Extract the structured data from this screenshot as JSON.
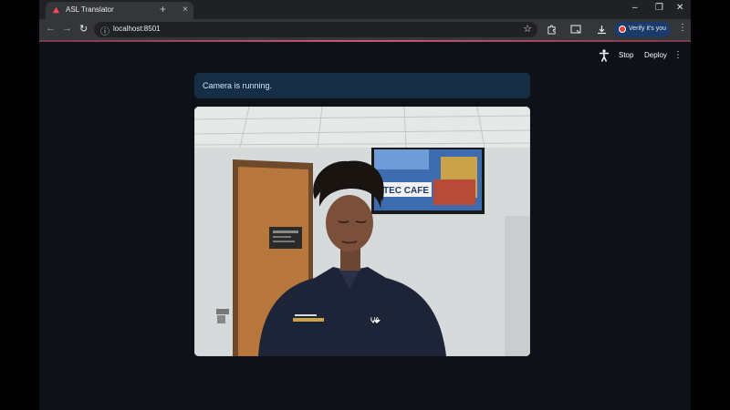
{
  "browser": {
    "tab_title": "ASL Translator",
    "tab_close": "×",
    "new_tab": "+",
    "url": "localhost:8501",
    "verify_label": "Verify it's you",
    "window_controls": [
      "–",
      "❐",
      "✕"
    ],
    "icons": [
      "back-icon",
      "forward-icon",
      "reload-icon",
      "info-icon",
      "star-icon",
      "extensions-icon",
      "cast-icon",
      "download-icon",
      "menu-icon"
    ]
  },
  "app": {
    "stop_label": "Stop",
    "deploy_label": "Deploy",
    "status_message": "Camera is running."
  },
  "video": {
    "tv_screen_text": "TEC CAFE",
    "door_sign_text": "",
    "logo_text": "UA"
  },
  "colors": {
    "app_bg": "#0e1117",
    "alert_bg": "#172d43",
    "alert_text": "#c7ebff",
    "tab_active": "#35363a",
    "verify_bg": "#1a3a6b"
  }
}
